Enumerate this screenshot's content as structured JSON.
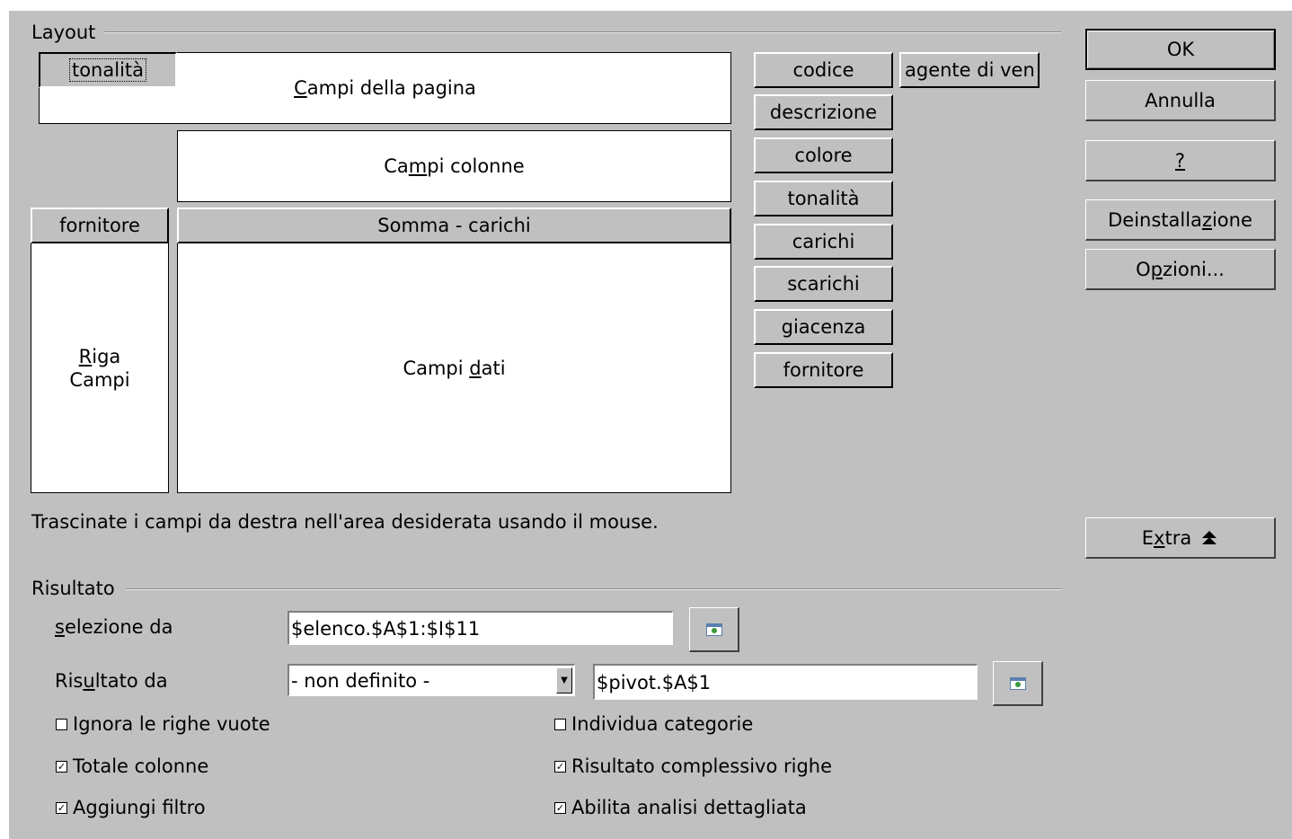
{
  "layout_group": {
    "label": "Layout",
    "page_area": {
      "label_pre": "",
      "label_u": "C",
      "label_post": "ampi della pagina"
    },
    "column_area": {
      "label_pre": "Ca",
      "label_u": "m",
      "label_post": "pi colonne"
    },
    "row_area": {
      "line1_u": "R",
      "line1_post": "iga",
      "line2": "Campi"
    },
    "data_area": {
      "label_pre": "Campi ",
      "label_u": "d",
      "label_post": "ati"
    },
    "page_field": "tonalità",
    "row_field": "fornitore",
    "data_field": "Somma - carichi",
    "available_fields": [
      "codice",
      "agente di ven",
      "descrizione",
      "colore",
      "tonalità",
      "carichi",
      "scarichi",
      "giacenza",
      "fornitore"
    ],
    "hint": "Trascinate i campi da destra nell'area desiderata usando il mouse."
  },
  "buttons": {
    "ok": "OK",
    "cancel": "Annulla",
    "help": "?",
    "remove_pre": "Deinstalla",
    "remove_u": "z",
    "remove_post": "ione",
    "options_pre": "O",
    "options_u": "p",
    "options_post": "zioni...",
    "extra_pre": "E",
    "extra_u": "x",
    "extra_post": "tra",
    "extra_icon": "double-chevron-up"
  },
  "result_group": {
    "label": "Risultato",
    "selection_label_u": "s",
    "selection_label_post": "elezione da",
    "selection_value": "$elenco.$A$1:$I$11",
    "output_label_pre": "Ris",
    "output_label_u": "u",
    "output_label_post": "ltato da",
    "output_select": "- non definito -",
    "output_value": "$pivot.$A$1",
    "checkboxes": {
      "ignore_empty": {
        "label": "Ignora le righe vuote",
        "checked": false
      },
      "identify_categories": {
        "label": "Individua categorie",
        "checked": false
      },
      "total_columns": {
        "label": "Totale colonne",
        "checked": true
      },
      "total_rows": {
        "label": "Risultato complessivo righe",
        "checked": true
      },
      "add_filter": {
        "label": "Aggiungi filtro",
        "checked": true
      },
      "enable_drilldown": {
        "label": "Abilita analisi dettagliata",
        "checked": true
      }
    }
  }
}
